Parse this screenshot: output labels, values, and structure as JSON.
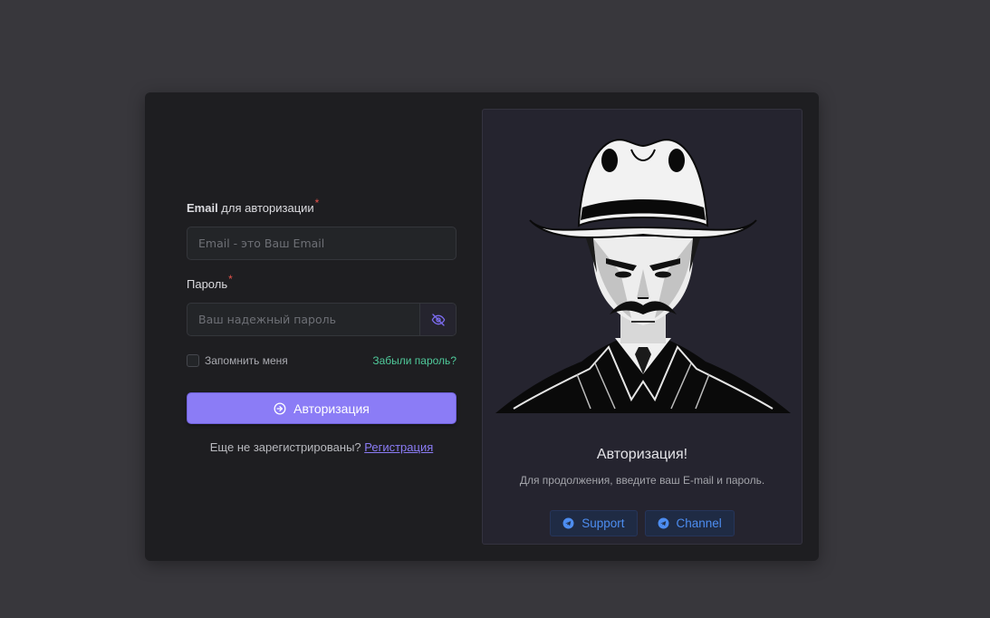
{
  "form": {
    "email_label_bold": "Email",
    "email_label_rest": " для авторизации",
    "required_mark": "*",
    "email_placeholder": "Email - это Ваш Email",
    "password_label": "Пароль",
    "password_placeholder": "Ваш надежный пароль",
    "password_toggle_icon": "eye-off-icon",
    "remember_label": "Запомнить меня",
    "remember_checked": false,
    "forgot_link": "Забыли пароль?",
    "submit_label": "Авторизация",
    "submit_icon": "sign-in-icon",
    "no_account_text": "Еще не зарегистрированы? ",
    "register_link": "Регистрация"
  },
  "panel": {
    "illustration": "cowboy-illustration",
    "title": "Авторизация!",
    "subtitle": "Для продолжения, введите ваш E-mail и пароль.",
    "buttons": [
      {
        "label": "Support",
        "icon": "telegram-icon"
      },
      {
        "label": "Channel",
        "icon": "telegram-icon"
      }
    ]
  },
  "colors": {
    "background": "#38373c",
    "card": "#1e1e21",
    "accent": "#8b7cf6",
    "link_green": "#4fc99a",
    "pill_text": "#4d8df0",
    "required": "#e5534b"
  }
}
